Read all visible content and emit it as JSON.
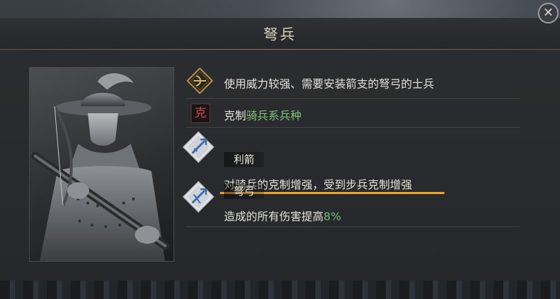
{
  "dialog": {
    "title": "弩兵",
    "close_icon": "close-icon"
  },
  "unit": {
    "description": "使用威力较强、需要安装箭支的弩弓的士兵",
    "counter_prefix": "克制",
    "counter_target": "骑兵系兵种",
    "counter_badge": "克"
  },
  "skills": [
    {
      "name": "利箭",
      "effect": "对骑兵的克制增强，受到步兵克制增强",
      "icon": "arrow-skill-icon"
    },
    {
      "name": "弩弓",
      "effect_prefix": "造成的所有伤害提高",
      "effect_value": "8%",
      "icon": "crossbow-skill-icon"
    }
  ],
  "colors": {
    "accent_green": "#7fc27a",
    "underline_orange": "#f0a72a",
    "title_gold": "#d9cfb5"
  }
}
